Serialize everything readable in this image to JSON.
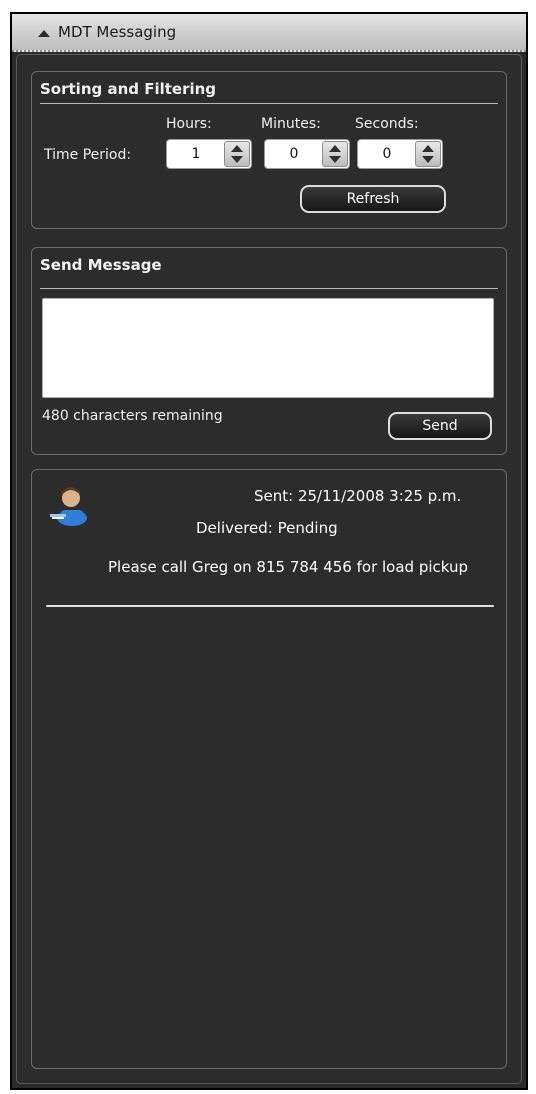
{
  "panel": {
    "title": "MDT Messaging"
  },
  "sorting": {
    "title": "Sorting and Filtering",
    "time_period_label": "Time Period:",
    "hours_label": "Hours:",
    "minutes_label": "Minutes:",
    "seconds_label": "Seconds:",
    "hours_value": "1",
    "minutes_value": "0",
    "seconds_value": "0",
    "refresh_label": "Refresh"
  },
  "send": {
    "title": "Send Message",
    "input_value": "",
    "remaining_text": "480 characters remaining",
    "send_label": "Send"
  },
  "messages": [
    {
      "icon": "user-icon",
      "sent_text": "Sent: 25/11/2008 3:25 p.m.",
      "delivered_text": "Delivered: Pending",
      "body": "Please call Greg on 815 784 456 for load pickup"
    }
  ],
  "colors": {
    "panel_bg": "#2c2c2c",
    "title_bar": "#d0d0d0",
    "text": "#ffffff",
    "icon_blue": "#2f7fd6"
  }
}
